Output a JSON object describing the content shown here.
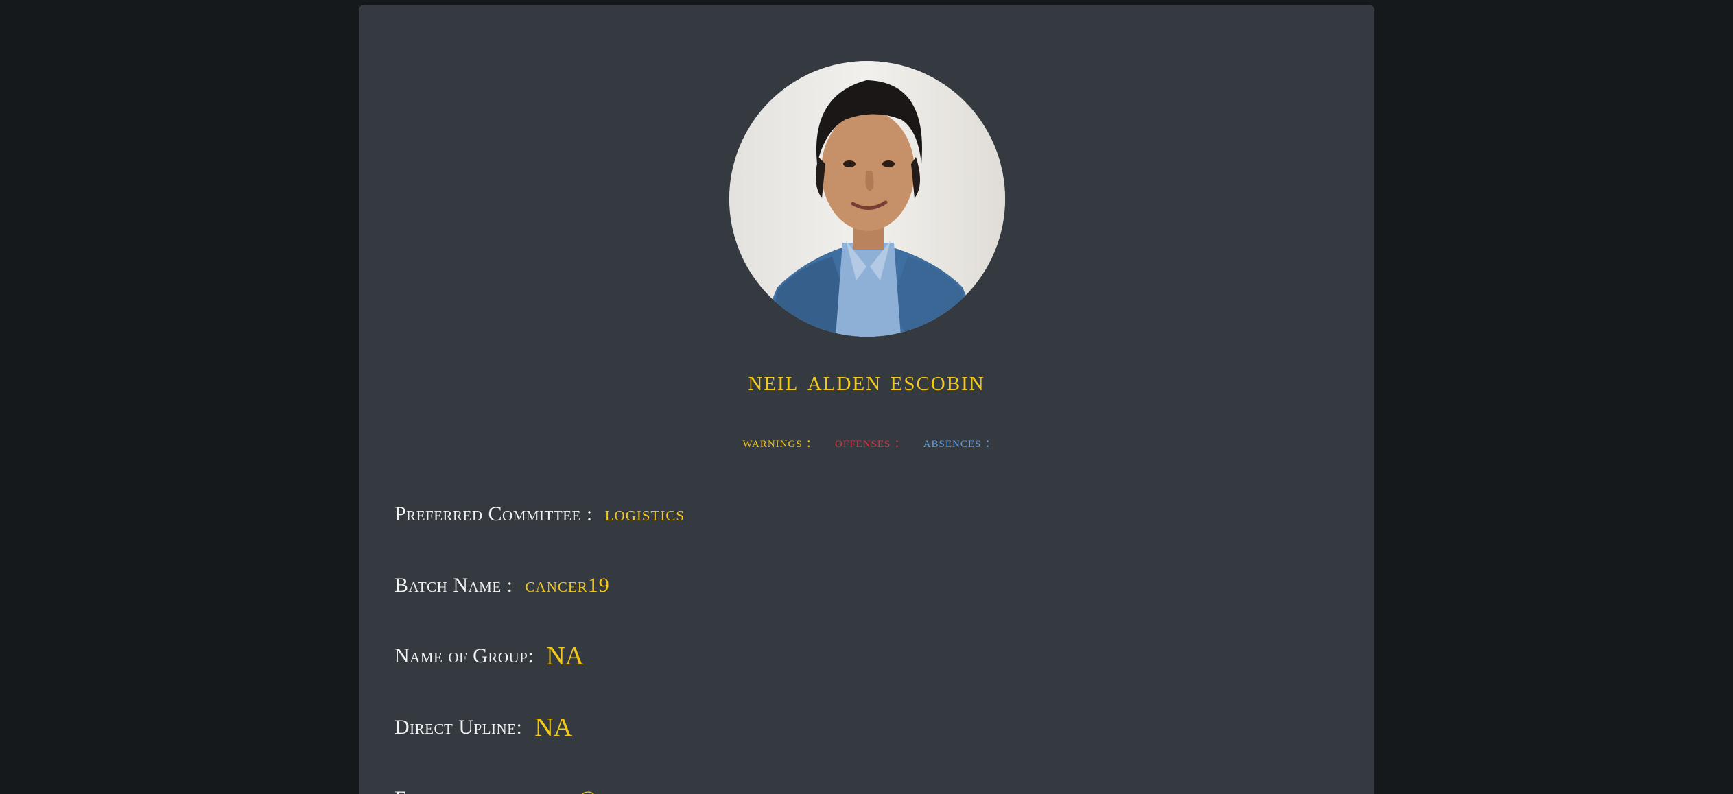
{
  "profile": {
    "name": "NEIL ALDEN ESCOBIN",
    "photo_alt": "profile photo"
  },
  "stats": {
    "warnings_label": "WARNINGS :",
    "offenses_label": "OFFENSES :",
    "absences_label": "ABSENCES :"
  },
  "fields": [
    {
      "label": "Preferred Committee :",
      "value": "LOGISTICS"
    },
    {
      "label": "Batch Name :",
      "value": "CANCER19"
    },
    {
      "label": "Name of Group:",
      "value": "NA"
    },
    {
      "label": "Direct Upline:",
      "value": "NA"
    },
    {
      "label": "Email :",
      "value": "ESCOBIN.NEIL@GMAIL.COM"
    }
  ],
  "colors": {
    "background": "#16191c",
    "card": "#343a40",
    "accent_yellow": "#f2c81a",
    "offense_red": "#dc3545",
    "absence_blue": "#5d9ee8",
    "label_white": "#f2f2f2"
  }
}
